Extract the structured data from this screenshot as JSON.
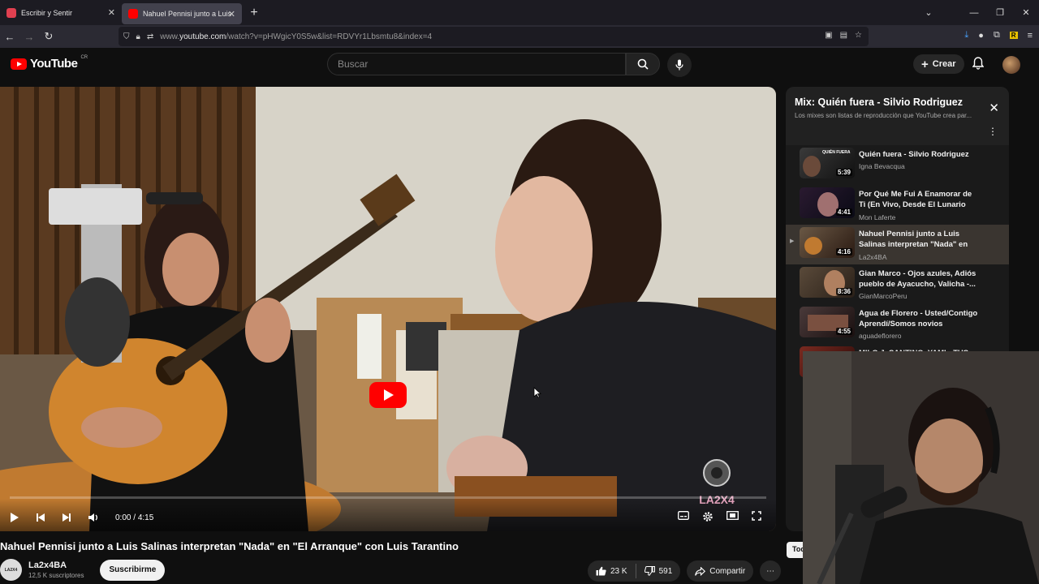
{
  "browser": {
    "tabs": [
      {
        "title": "Escribir y Sentir",
        "favicon_color": "#e04050",
        "active": false
      },
      {
        "title": "Nahuel Pennisi junto a Luis Salin",
        "favicon_color": "#ff0000",
        "active": true
      }
    ],
    "new_tab_label": "+",
    "url_prefix": "www.",
    "url_domain": "youtube.com",
    "url_path": "/watch?v=pHWgicY0S5w&list=RDVYr1Lbsmtu8&index=4"
  },
  "youtube": {
    "logo_text": "YouTube",
    "country_code": "CR",
    "search_placeholder": "Buscar",
    "create_label": "Crear"
  },
  "player": {
    "time_current": "0:00",
    "time_separator": "/",
    "time_total": "4:15",
    "watermark_text": "LA2X4",
    "progress_fraction": 0.0
  },
  "video": {
    "title": "Nahuel Pennisi junto a Luis Salinas interpretan \"Nada\" en \"El Arranque\" con Luis Tarantino",
    "channel_name": "La2x4BA",
    "channel_avatar_text": "LA2X4",
    "subscribers": "12,5 K suscriptores",
    "subscribe_label": "Suscribirme",
    "likes": "23 K",
    "dislikes": "591",
    "share_label": "Compartir"
  },
  "playlist": {
    "title": "Mix: Quién fuera - Silvio Rodriguez",
    "subtitle": "Los mixes son listas de reproducción que YouTube crea par...",
    "items": [
      {
        "title": "Quién fuera - Silvio Rodriguez",
        "channel": "Igna Bevacqua",
        "duration": "5:39",
        "thumb_text": "QUIÉN FUERA",
        "active": false
      },
      {
        "title": "Por Qué Me Fui A Enamorar de Ti (En Vivo, Desde El Lunario del...",
        "channel": "Mon Laferte",
        "duration": "4:41",
        "active": false
      },
      {
        "title": "Nahuel Pennisi junto a Luis Salinas interpretan \"Nada\" en \"El...",
        "channel": "La2x4BA",
        "duration": "4:16",
        "active": true
      },
      {
        "title": "Gian Marco - Ojos azules, Adiós pueblo de Ayacucho, Valicha -...",
        "channel": "GianMarcoPeru",
        "duration": "8:36",
        "active": false
      },
      {
        "title": "Agua de Florero - Usted/Contigo Aprendí/Somos novios",
        "channel": "aguadeflorero",
        "duration": "4:55",
        "active": false
      },
      {
        "title": "MILO J, SANTINO, YAMI - TUS",
        "channel": "",
        "duration": "",
        "active": false
      }
    ]
  },
  "sidebar_chip": "Tod",
  "colors": {
    "brand_red": "#ff0000",
    "background": "#0f0f0f",
    "panel_bg": "#1a1a1a"
  }
}
